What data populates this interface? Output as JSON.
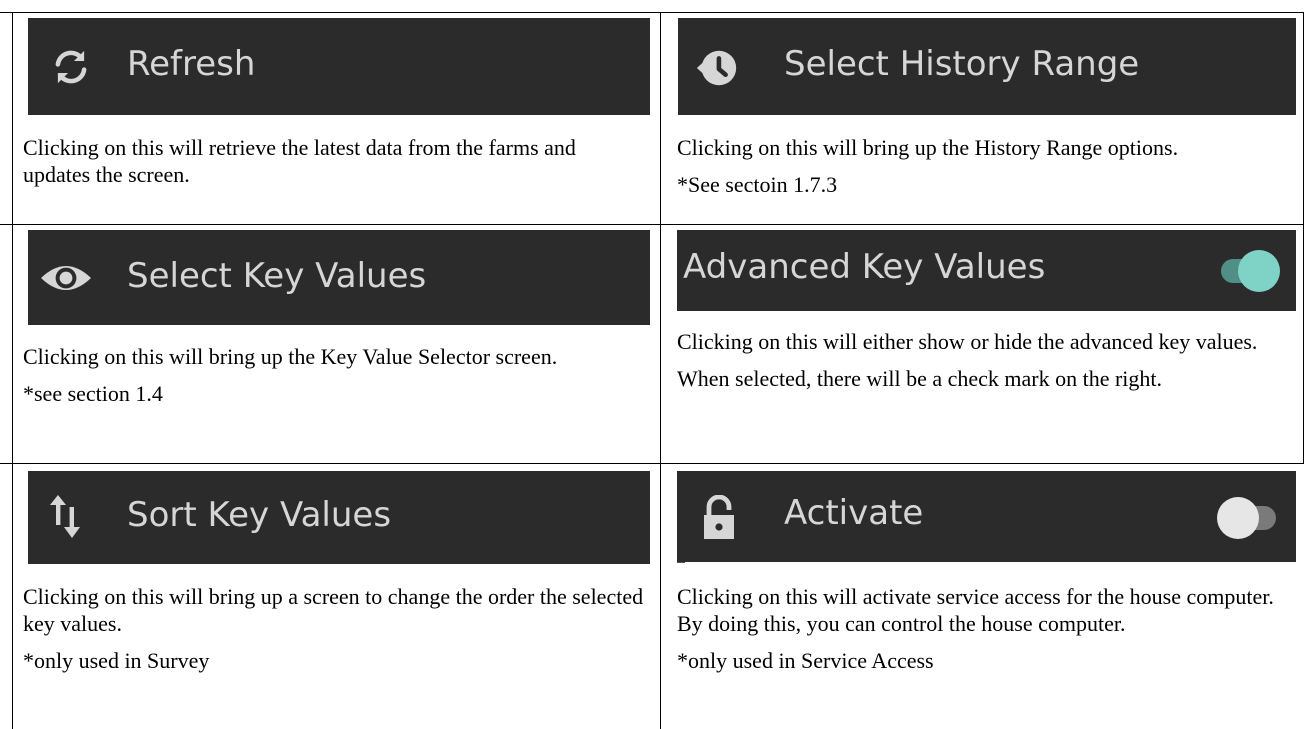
{
  "cells": [
    {
      "bar_label": "Refresh",
      "icon": "refresh-icon",
      "paragraphs": [
        "Clicking on this will retrieve the latest data from the farms and updates the screen."
      ]
    },
    {
      "bar_label": "Select History Range",
      "icon": "history-icon",
      "paragraphs": [
        "Clicking on this will bring up the History Range options.",
        "*See sectoin 1.7.3"
      ]
    },
    {
      "bar_label": "Select Key Values",
      "icon": "eye-icon",
      "paragraphs": [
        "Clicking on this will bring up the Key Value Selector screen.",
        "*see section 1.4"
      ]
    },
    {
      "bar_label": "Advanced Key Values",
      "toggle": "on",
      "paragraphs": [
        "Clicking on this will either show or hide the advanced key values.",
        "When selected, there will be a check mark on the right."
      ]
    },
    {
      "bar_label": "Sort Key Values",
      "icon": "sort-arrows-icon",
      "paragraphs": [
        "Clicking on this will bring up a screen to change the order the selected key values.",
        "*only used in Survey"
      ]
    },
    {
      "bar_label": "Activate",
      "icon": "unlock-icon",
      "toggle": "off",
      "paragraphs": [
        "Clicking on this will activate service access for the house computer. By doing this, you can control the house computer.",
        "*only used in Service Access"
      ]
    }
  ],
  "colors": {
    "bar_bg": "#2b2b2b",
    "bar_text": "#d6d6d6",
    "toggle_on_thumb": "#7fd3c6",
    "toggle_on_track": "#4f8f86",
    "toggle_off_thumb": "#e6e6e6",
    "toggle_off_track": "#7a7a7a"
  }
}
